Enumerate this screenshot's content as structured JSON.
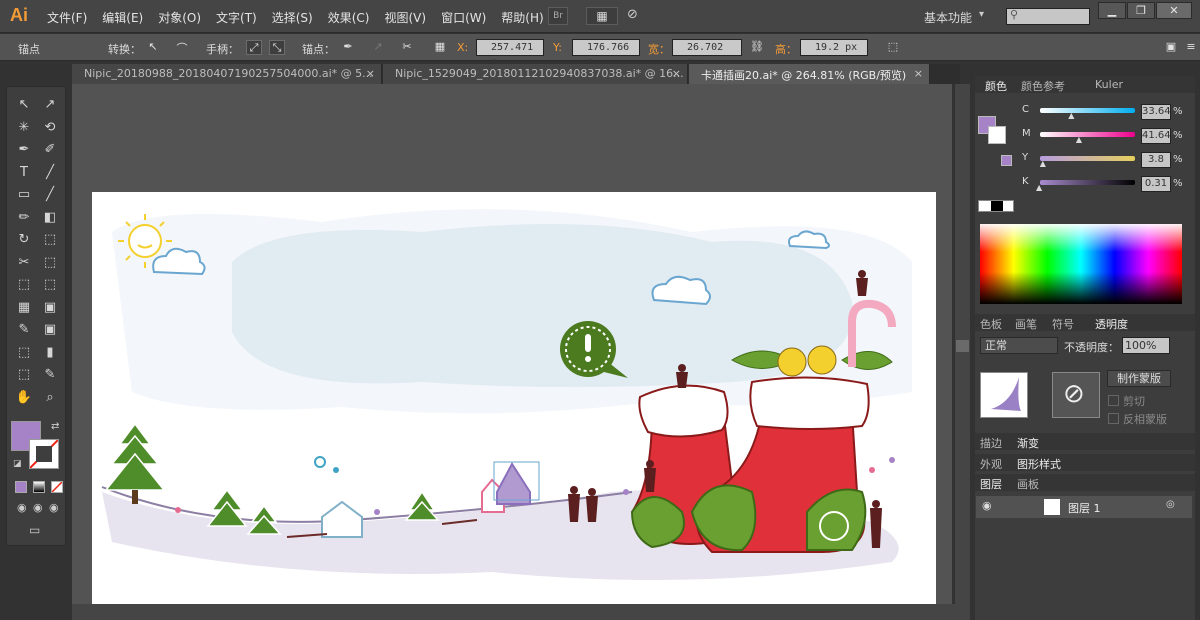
{
  "app": {
    "logo": "Ai",
    "workspace": "基本功能",
    "dd_arrow": "▾",
    "min": "▁",
    "restore": "❐",
    "close": "✕"
  },
  "menu": [
    "文件(F)",
    "编辑(E)",
    "对象(O)",
    "文字(T)",
    "选择(S)",
    "效果(C)",
    "视图(V)",
    "窗口(W)",
    "帮助(H)"
  ],
  "menu_icons": [
    "Br",
    "▦",
    "⊘"
  ],
  "control": {
    "selection": "锚点",
    "convert": "转换：",
    "handles": "手柄：",
    "anchors": "锚点：",
    "x_label": "X:",
    "x_value": "257.471 p",
    "y_label": "Y:",
    "y_value": "176.766 p",
    "w_label": "宽：",
    "w_value": "26.702 px",
    "h_label": "高：",
    "h_value": "19.2 px"
  },
  "tabs": [
    {
      "label": "Nipic_20180988_20180407190257504000.ai* @ 5...",
      "close": "×"
    },
    {
      "label": "Nipic_1529049_20180112102940837038.ai* @ 16...",
      "close": "×"
    },
    {
      "label": "卡通插画20.ai* @ 264.81% (RGB/预览)",
      "close": "×"
    }
  ],
  "tools": [
    "↖",
    "↗",
    "✳",
    "⟲",
    "✒",
    "✐",
    "T",
    "╱",
    "▭",
    "╱",
    "✏",
    "◧",
    "↻",
    "⬚",
    "✂",
    "⬚",
    "⬚",
    "⬚",
    "▦",
    "▣",
    "✎",
    "▣",
    "⬚",
    "▮",
    "⬚",
    "✎",
    "✋",
    "⌕"
  ],
  "color_panel": {
    "tabs": [
      "颜色",
      "颜色参考",
      "Kuler"
    ],
    "sliders": [
      {
        "label": "C",
        "value": "33.64",
        "pos": 0.34,
        "gradient": "linear-gradient(to right,#fff,#00aeef)"
      },
      {
        "label": "M",
        "value": "41.64",
        "pos": 0.42,
        "gradient": "linear-gradient(to right,#fff,#ec008c)"
      },
      {
        "label": "Y",
        "value": "3.8",
        "pos": 0.04,
        "gradient": "linear-gradient(to right,#b79de0,#e6cf5d)"
      },
      {
        "label": "K",
        "value": "0.31",
        "pos": 0.0,
        "gradient": "linear-gradient(to right,#a88bcd,#000)"
      }
    ],
    "pct": "%",
    "fill_color": "#a583c6"
  },
  "second_tabs": [
    "色板",
    "画笔",
    "符号",
    "透明度"
  ],
  "transparency": {
    "mode": "正常",
    "opacity_label": "不透明度：",
    "opacity": "100%",
    "make_mask": "制作蒙版",
    "clip": "剪切",
    "invert": "反相蒙版"
  },
  "stroke_tabs": [
    "描边",
    "渐变"
  ],
  "appearance_tabs": [
    "外观",
    "图形样式"
  ],
  "layers_tabs": [
    "图层",
    "画板"
  ],
  "layer": {
    "name": "图层 1"
  }
}
